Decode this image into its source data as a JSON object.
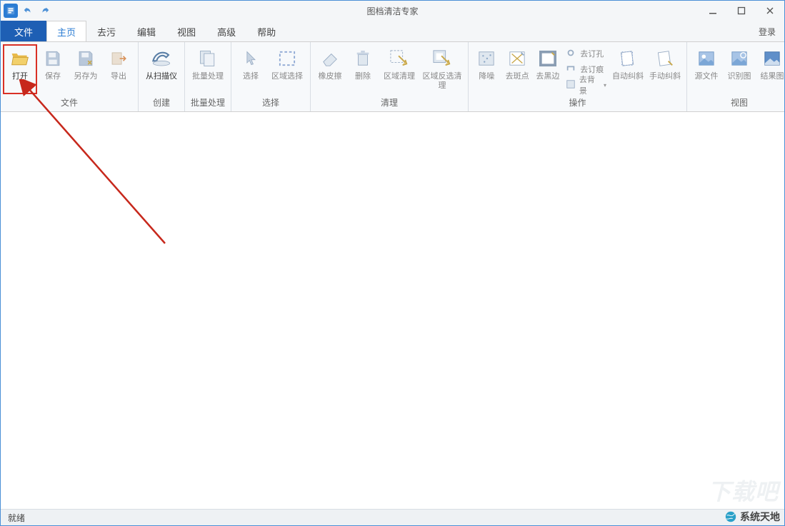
{
  "window": {
    "title": "图档清洁专家"
  },
  "tabs": {
    "file": "文件",
    "items": [
      "主页",
      "去污",
      "编辑",
      "视图",
      "高级",
      "帮助"
    ],
    "active_index": 0,
    "login": "登录"
  },
  "ribbon": {
    "groups": {
      "file_ops": {
        "label": "文件",
        "open": "打开",
        "save": "保存",
        "save_as": "另存为",
        "export": "导出"
      },
      "create": {
        "label": "创建",
        "from_scanner": "从扫描仪"
      },
      "batch": {
        "label": "批量处理",
        "batch": "批量处理"
      },
      "select": {
        "label": "选择",
        "select": "选择",
        "area_select": "区域选择"
      },
      "clean": {
        "label": "清理",
        "eraser": "橡皮擦",
        "delete": "删除",
        "area_clean": "区域清理",
        "area_inverse_clean": "区域反选清理"
      },
      "operate": {
        "label": "操作",
        "denoise": "降噪",
        "despeckle": "去斑点",
        "deblack": "去黑边",
        "depunch": "去订孔",
        "destaple": "去订痕",
        "debg": "去背景",
        "auto_deskew": "自动纠斜",
        "manual_deskew": "手动纠斜"
      },
      "view": {
        "label": "视图",
        "source": "源文件",
        "recognized": "识别图",
        "result": "结果图"
      }
    }
  },
  "status": {
    "text": "就绪"
  },
  "watermark": {
    "text": "系统天地"
  }
}
